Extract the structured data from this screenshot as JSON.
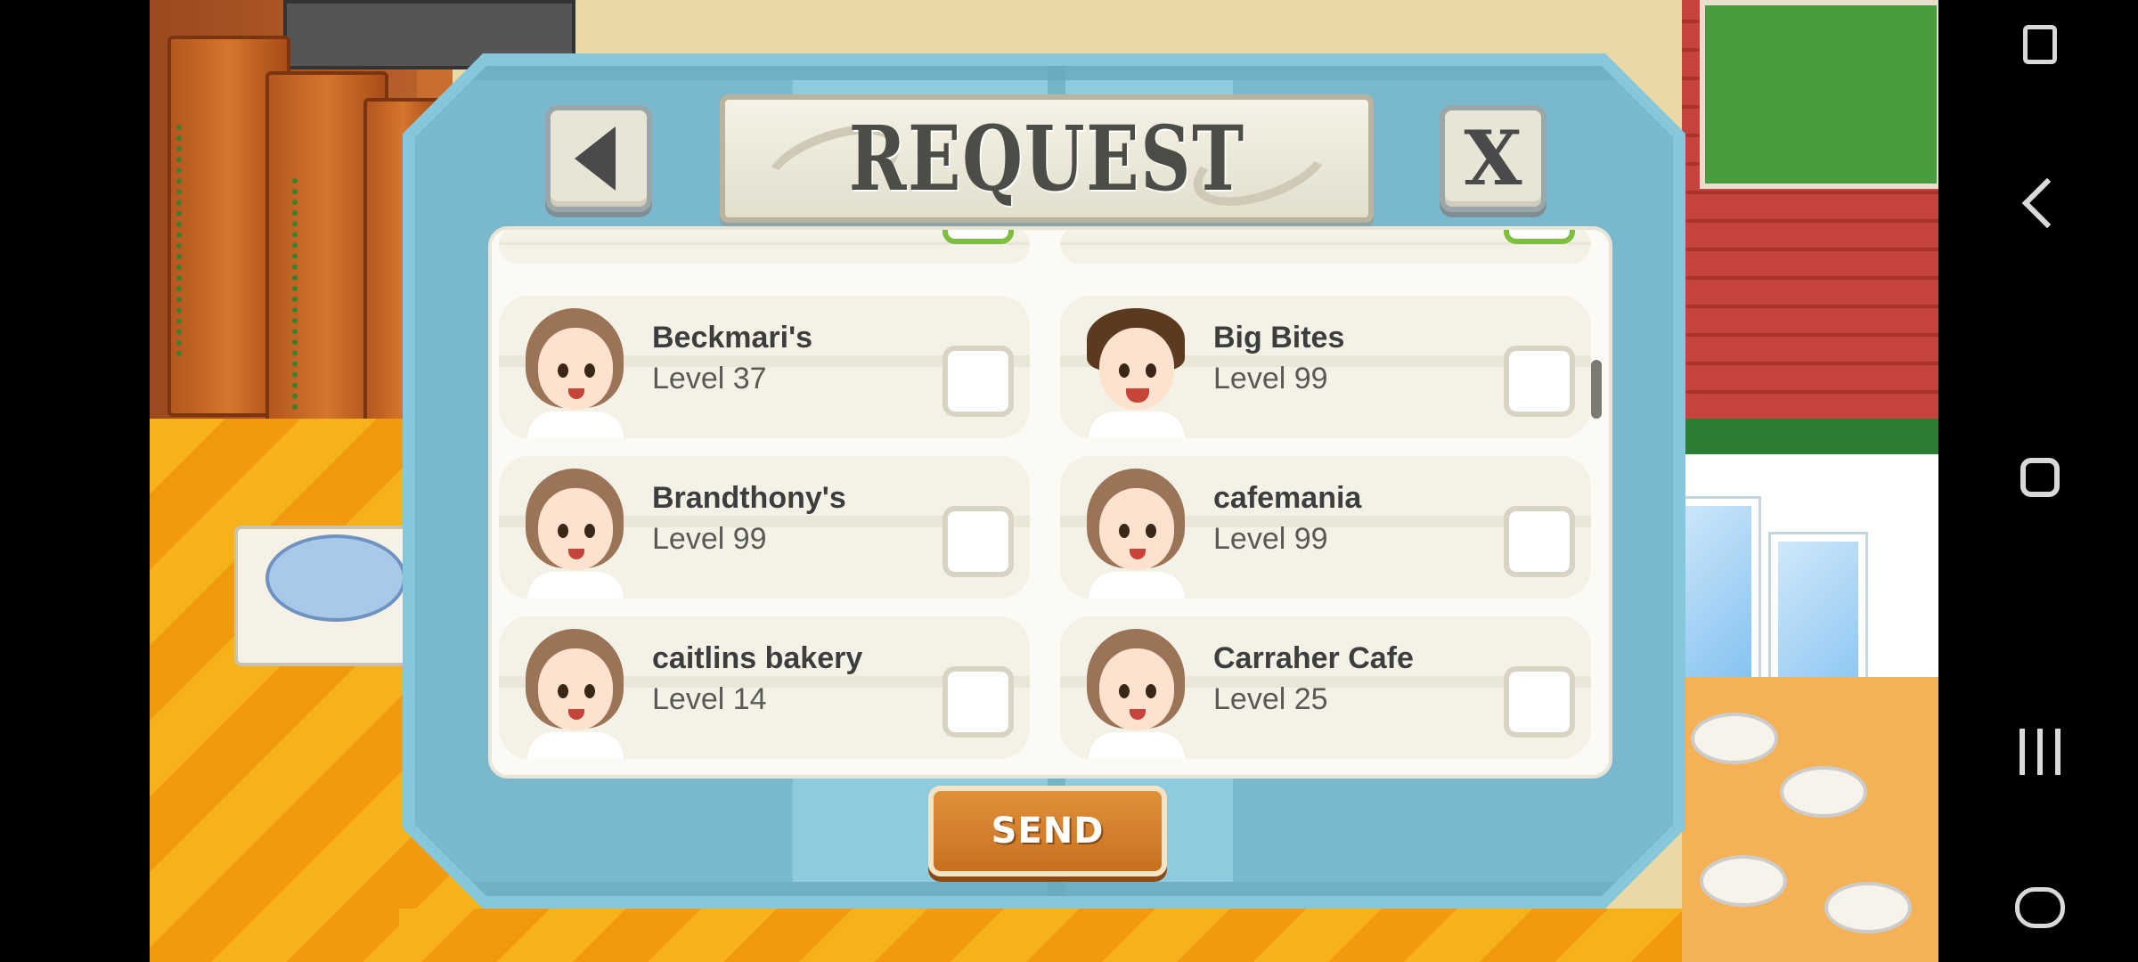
{
  "dialog": {
    "title": "REQUEST",
    "close_label": "X",
    "send_label": "SEND"
  },
  "friends": [
    {
      "name": "Beckmari's",
      "level": "Level 37",
      "avatar": "female-chef-avatar",
      "checked": false
    },
    {
      "name": "Big Bites",
      "level": "Level 99",
      "avatar": "male-chef-avatar",
      "checked": false
    },
    {
      "name": "Brandthony's",
      "level": "Level 99",
      "avatar": "female-chef-avatar",
      "checked": false
    },
    {
      "name": "cafemania",
      "level": "Level 99",
      "avatar": "female-chef-avatar",
      "checked": false
    },
    {
      "name": "caitlins bakery",
      "level": "Level 14",
      "avatar": "female-chef-avatar",
      "checked": false
    },
    {
      "name": "Carraher Cafe",
      "level": "Level 25",
      "avatar": "female-chef-avatar",
      "checked": false
    }
  ],
  "colors": {
    "dialog_frame": "#86c7dc",
    "send_button": "#c7701f",
    "checkbox_border": "#d8d3c2"
  },
  "icons": {
    "back": "left-triangle-icon",
    "close": "x-icon",
    "system_back": "chevron-left-icon",
    "system_home": "rounded-square-icon",
    "system_recents": "three-bars-icon",
    "system_tool": "screen-lock-icon",
    "system_game": "gamepad-icon"
  }
}
